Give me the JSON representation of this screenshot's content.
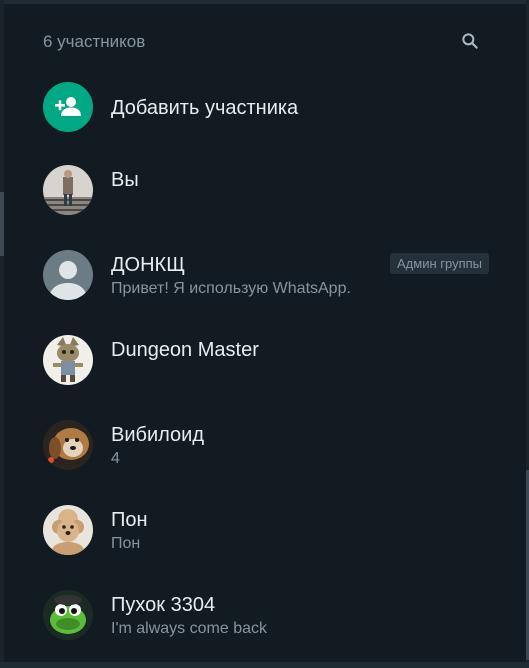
{
  "header": {
    "participants_count": "6 участников",
    "search_icon": "search-icon"
  },
  "add_participant": {
    "label": "Добавить участника",
    "icon": "add-person-icon",
    "accent": "#00a884"
  },
  "participants": [
    {
      "name": "Вы",
      "status": "",
      "badge": ""
    },
    {
      "name": "ДОНКЩ",
      "status": "Привет! Я использую WhatsApp.",
      "badge": "Админ группы"
    },
    {
      "name": "Dungeon Master",
      "status": "",
      "badge": ""
    },
    {
      "name": "Вибилоид",
      "status": "4",
      "badge": ""
    },
    {
      "name": "Пон",
      "status": "Пон",
      "badge": ""
    },
    {
      "name": "Пухок 3304",
      "status": "I'm always come back",
      "badge": ""
    }
  ],
  "colors": {
    "background": "#111b21",
    "primary_text": "#e9edef",
    "secondary_text": "#8696a0",
    "badge_bg": "#233138"
  }
}
